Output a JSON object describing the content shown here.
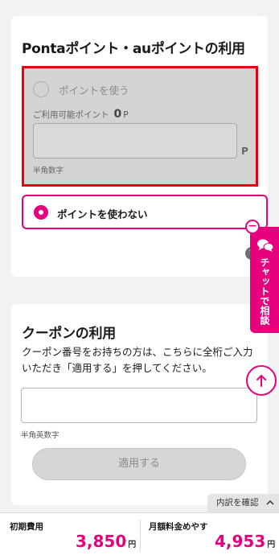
{
  "points_section": {
    "title": "Pontaポイント・auポイントの利用",
    "use_option_label": "ポイントを使う",
    "available_label": "ご利用可能ポイント",
    "available_value": "0",
    "available_unit": "P",
    "input_unit": "P",
    "input_hint": "半角数字",
    "no_use_option_label": "ポイントを使わない",
    "selected_option": "ポイントを使わない",
    "help_icon_text": "?"
  },
  "coupon_section": {
    "title": "クーポンの利用",
    "description": "クーポン番号をお持ちの方は、こちらに全桁ご入力いただき「適用する」を押してください。",
    "input_value": "",
    "input_hint": "半角英数字",
    "apply_button_label": "適用する"
  },
  "chat_widget": {
    "label": "チャットで相談",
    "minimize_symbol": "−"
  },
  "footer": {
    "breakdown_label": "内訳を確認",
    "initial_fee_label": "初期費用",
    "initial_fee_value": "3,850",
    "initial_fee_unit": "円",
    "monthly_fee_label": "月額料金めやす",
    "monthly_fee_value": "4,953",
    "monthly_fee_unit": "円"
  },
  "colors": {
    "accent": "#e6007e",
    "highlight_border": "#e60012",
    "disabled_panel": "#d3d3d3"
  }
}
